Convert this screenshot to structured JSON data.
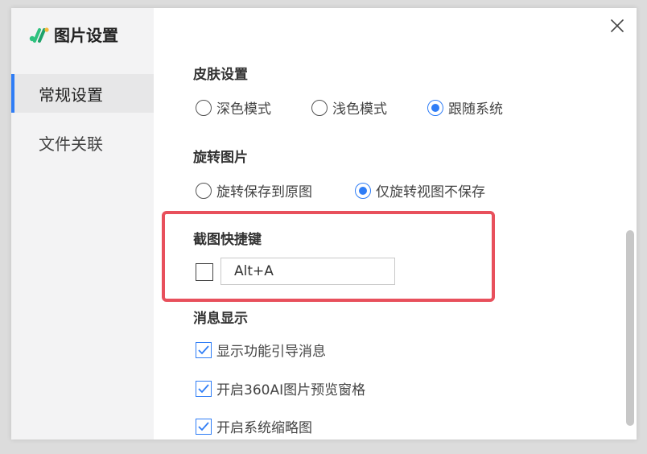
{
  "app": {
    "title": "图片设置"
  },
  "sidebar": {
    "items": [
      {
        "label": "常规设置",
        "active": true
      },
      {
        "label": "文件关联",
        "active": false
      }
    ]
  },
  "sections": {
    "skin": {
      "title": "皮肤设置",
      "options": [
        {
          "label": "深色模式",
          "checked": false
        },
        {
          "label": "浅色模式",
          "checked": false
        },
        {
          "label": "跟随系统",
          "checked": true
        }
      ]
    },
    "rotate": {
      "title": "旋转图片",
      "options": [
        {
          "label": "旋转保存到原图",
          "checked": false
        },
        {
          "label": "仅旋转视图不保存",
          "checked": true
        }
      ]
    },
    "screenshot": {
      "title": "截图快捷键",
      "enabled": false,
      "hotkey": "Alt+A"
    },
    "messages": {
      "title": "消息显示",
      "options": [
        {
          "label": "显示功能引导消息",
          "checked": true
        },
        {
          "label": "开启360AI图片预览窗格",
          "checked": true
        },
        {
          "label": "开启系统缩略图",
          "checked": true
        }
      ]
    }
  },
  "colors": {
    "accent": "#2f7df6",
    "highlight": "#e8505c"
  },
  "icons": {
    "logo": "360-logo-icon",
    "close": "close-icon",
    "check": "checkmark-icon"
  }
}
